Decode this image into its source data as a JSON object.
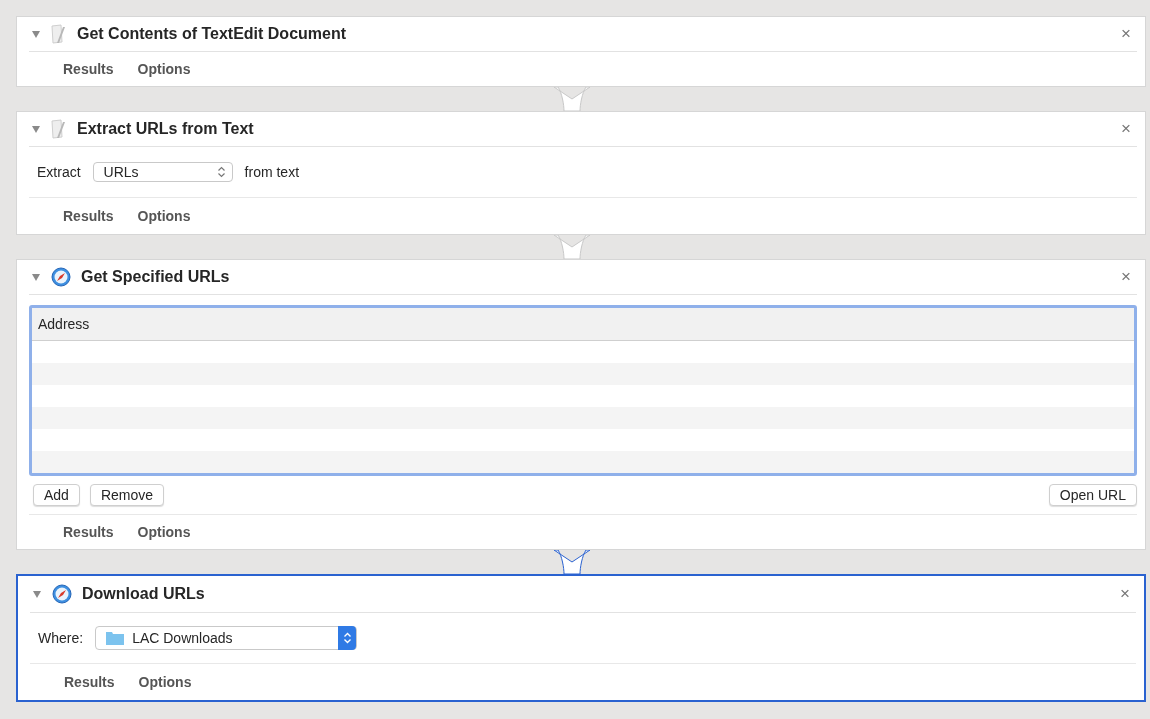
{
  "actions": [
    {
      "title": "Get Contents of TextEdit Document",
      "close": "×",
      "expanded": true,
      "selected": false,
      "body": {
        "kind": "none"
      },
      "footer_tabs": [
        "Results",
        "Options"
      ]
    },
    {
      "title": "Extract URLs from Text",
      "close": "×",
      "expanded": true,
      "selected": false,
      "body": {
        "kind": "select_row",
        "label": "Extract",
        "value": "URLs",
        "suffix": "from text"
      },
      "footer_tabs": [
        "Results",
        "Options"
      ]
    },
    {
      "title": "Get Specified URLs",
      "close": "×",
      "expanded": true,
      "selected": false,
      "body": {
        "kind": "url_table",
        "column": "Address",
        "focused": true,
        "buttons_left": [
          "Add",
          "Remove"
        ],
        "button_right": "Open URL"
      },
      "footer_tabs": [
        "Results",
        "Options"
      ]
    },
    {
      "title": "Download URLs",
      "close": "×",
      "expanded": true,
      "selected": true,
      "body": {
        "kind": "folder_popup",
        "label": "Where:",
        "value": "LAC Downloads"
      },
      "footer_tabs": [
        "Results",
        "Options"
      ]
    }
  ]
}
